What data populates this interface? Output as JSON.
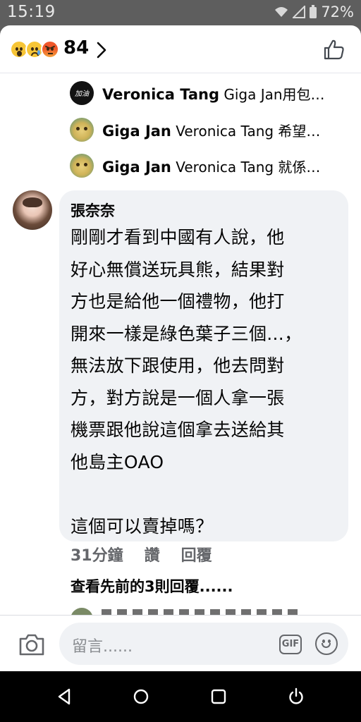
{
  "status_bar": {
    "time": "15:19",
    "battery": "72%",
    "icons": [
      "wifi-icon",
      "signal-icon",
      "battery-icon"
    ]
  },
  "reactions": {
    "emojis": [
      "wow-reaction-icon",
      "sad-reaction-icon",
      "angry-reaction-icon"
    ],
    "count": "84",
    "like_icon": "thumbs-up-icon"
  },
  "replies": [
    {
      "author": "Veronica Tang",
      "text": "Giga Jan用包…",
      "avatar": "avatar-veronica"
    },
    {
      "author": "Giga Jan",
      "text": "Veronica Tang 希望…",
      "avatar": "avatar-giga"
    },
    {
      "author": "Giga Jan",
      "text": "Veronica Tang 就係…",
      "avatar": "avatar-giga"
    }
  ],
  "comment": {
    "author": "張奈奈",
    "lines": [
      "剛剛才看到中國有人說，他",
      "好心無償送玩具熊，結果對",
      "方也是給他一個禮物，他打",
      "開來一樣是綠色葉子三個...，",
      "無法放下跟使用，他去問對",
      "方，對方說是一個人拿一張",
      "機票跟他說這個拿去送給其",
      "他島主OAO",
      "",
      "這個可以賣掉嗎？"
    ],
    "time": "31分鐘",
    "like_label": "讚",
    "reply_label": "回覆",
    "view_more": "查看先前的3則回覆......"
  },
  "composer": {
    "placeholder": "留言......",
    "gif_label": "GIF"
  },
  "colors": {
    "status_bar_bg": "#5e5e5e",
    "bubble_bg": "#f0f2f5",
    "meta_text": "#65676b"
  }
}
